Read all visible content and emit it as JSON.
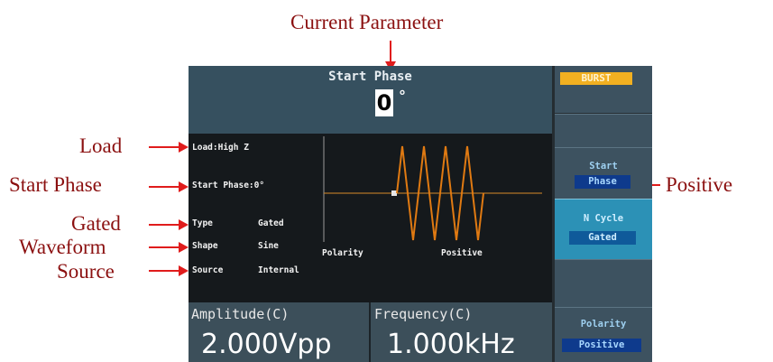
{
  "annotations": {
    "current_parameter": "Current Parameter",
    "load": "Load",
    "start_phase": "Start Phase",
    "gated": "Gated",
    "waveform": "Waveform",
    "source": "Source",
    "positive": "Positive"
  },
  "header": {
    "title": "Start Phase",
    "value": "0",
    "unit": "°"
  },
  "info": {
    "load": "Load:High Z",
    "start_phase": "Start Phase:0°",
    "type_label": "Type",
    "type_value": "Gated",
    "shape_label": "Shape",
    "shape_value": "Sine",
    "source_label": "Source",
    "source_value": "Internal",
    "polarity_label": "Polarity",
    "polarity_value": "Positive"
  },
  "bottom": {
    "amplitude_label": "Amplitude(C)",
    "amplitude_value": "2.000Vpp",
    "frequency_label": "Frequency(C)",
    "frequency_value": "1.000kHz"
  },
  "menu": {
    "burst_tag": "BURST",
    "start_phase_line1": "Start",
    "start_phase_line2": "Phase",
    "ncycle_label": "N Cycle",
    "ncycle_selected": "Gated",
    "polarity_label": "Polarity",
    "polarity_selected": "Positive"
  },
  "colors": {
    "annotation_text": "#8b1010",
    "annotation_arrow": "#e01c1c",
    "burst_tag": "#f2b021",
    "waveform": "#e07a12",
    "active_menu": "#2c91b6"
  }
}
